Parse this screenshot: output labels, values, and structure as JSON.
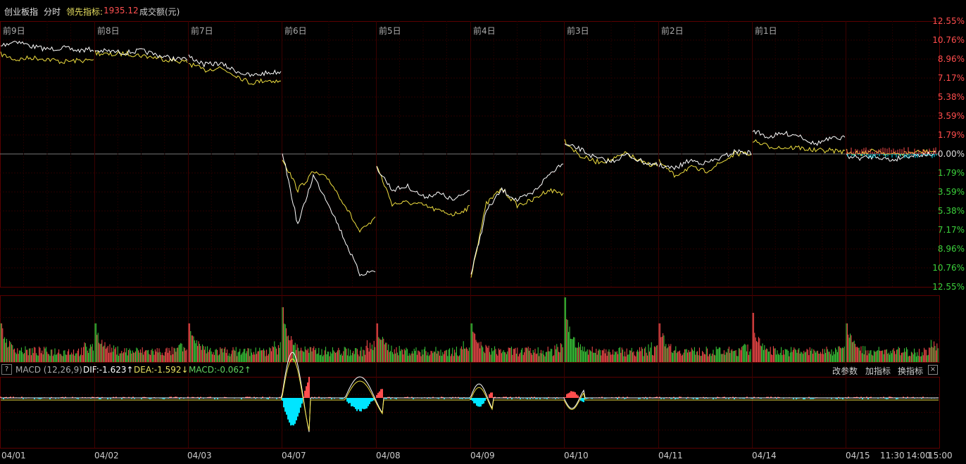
{
  "header": {
    "index_name": "创业板指",
    "mode": "分时",
    "lead_label": "领先指标:",
    "lead_value": "1935.12",
    "volume_label": "成交额(元)"
  },
  "day_labels": [
    "前9日",
    "前8日",
    "前7日",
    "前6日",
    "前5日",
    "前4日",
    "前3日",
    "前2日",
    "前1日"
  ],
  "y_axis": {
    "up_labels": [
      "12.55%",
      "10.76%",
      "8.96%",
      "7.17%",
      "5.38%",
      "3.59%",
      "1.79%"
    ],
    "zero_label": "0.00%",
    "down_labels": [
      "1.79%",
      "3.59%",
      "5.38%",
      "7.17%",
      "8.96%",
      "10.76%",
      "12.55%"
    ]
  },
  "macd": {
    "help_icon": "?",
    "title": "MACD (12,26,9)",
    "dif": "DIF:-1.623↑",
    "dea": "DEA:-1.592↓",
    "macd": "MACD:-0.062↑",
    "buttons": [
      "改参数",
      "加指标",
      "换指标"
    ],
    "close": "×"
  },
  "x_axis": [
    "04/01",
    "04/02",
    "04/03",
    "04/07",
    "04/08",
    "04/09",
    "04/10",
    "04/11",
    "04/14",
    "04/15",
    "11:30",
    "14:00",
    "15:00"
  ],
  "colors": {
    "up": "#ff4d4d",
    "down": "#3cd23c",
    "price_line": "#ffffff",
    "lead_line": "#f0e040",
    "grid": "#3a0000",
    "cyan": "#00e5ff"
  }
}
